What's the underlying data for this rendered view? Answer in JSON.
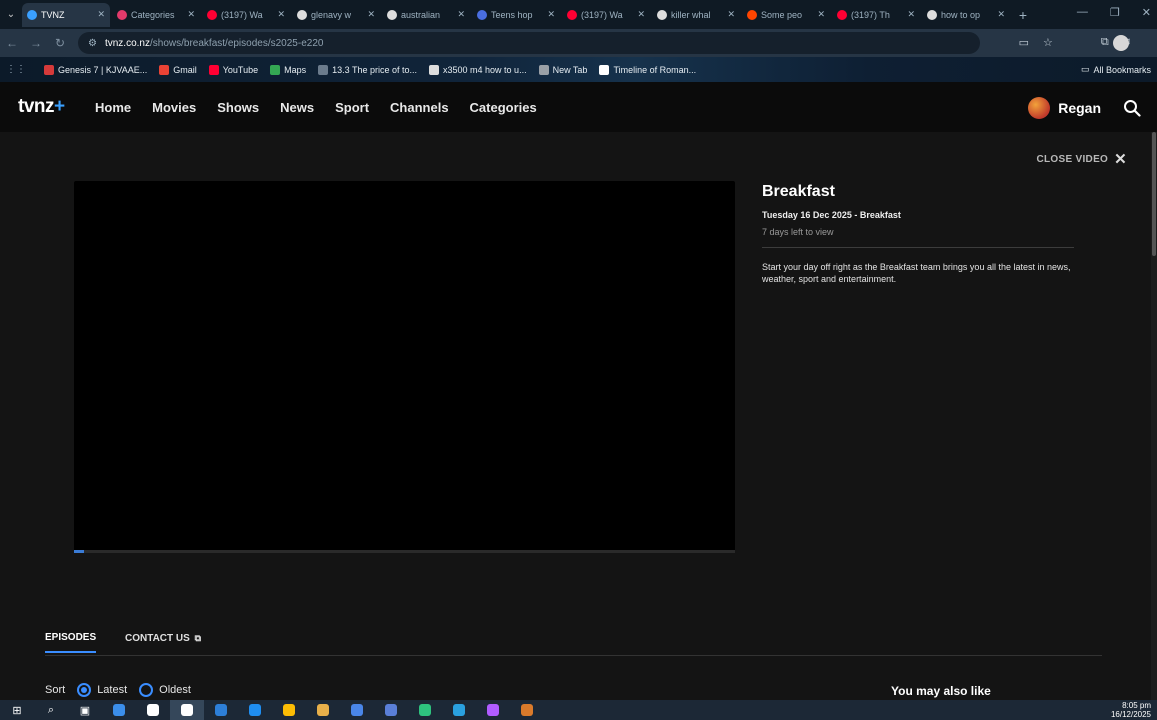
{
  "browser": {
    "tabs": [
      {
        "title": "TVNZ",
        "active": true,
        "icon_color": "#3aa0ff"
      },
      {
        "title": "Categories",
        "active": false,
        "icon_color": "#e23a6b"
      },
      {
        "title": "(3197) Wa",
        "active": false,
        "icon_color": "#ff0033"
      },
      {
        "title": "glenavy w",
        "active": false,
        "icon_color": "#dddddd"
      },
      {
        "title": "australian",
        "active": false,
        "icon_color": "#dddddd"
      },
      {
        "title": "Teens hop",
        "active": false,
        "icon_color": "#4a6ee0"
      },
      {
        "title": "(3197) Wa",
        "active": false,
        "icon_color": "#ff0033"
      },
      {
        "title": "killer whal",
        "active": false,
        "icon_color": "#dddddd"
      },
      {
        "title": "Some peo",
        "active": false,
        "icon_color": "#ff4500"
      },
      {
        "title": "(3197) Th",
        "active": false,
        "icon_color": "#ff0033"
      },
      {
        "title": "how to op",
        "active": false,
        "icon_color": "#dddddd"
      }
    ],
    "url_host": "tvnz.co.nz",
    "url_path": "/shows/breakfast/episodes/s2025-e220",
    "bookmarks": [
      {
        "label": "Genesis 7 | KJVAAE...",
        "icon_color": "#d63a3a"
      },
      {
        "label": "Gmail",
        "icon_color": "#ea4335"
      },
      {
        "label": "YouTube",
        "icon_color": "#ff0033"
      },
      {
        "label": "Maps",
        "icon_color": "#34a853"
      },
      {
        "label": "13.3 The price of to...",
        "icon_color": "#6b7b8c"
      },
      {
        "label": "x3500 m4 how to u...",
        "icon_color": "#dddddd"
      },
      {
        "label": "New Tab",
        "icon_color": "#9aa0a6"
      },
      {
        "label": "Timeline of Roman...",
        "icon_color": "#ffffff"
      }
    ],
    "all_bookmarks": "All Bookmarks"
  },
  "site": {
    "logo_text": "tvnz",
    "logo_plus": "+",
    "nav": [
      "Home",
      "Movies",
      "Shows",
      "News",
      "Sport",
      "Channels",
      "Categories"
    ],
    "user_name": "Regan",
    "close_video": "CLOSE VIDEO",
    "close_glyph": "✕"
  },
  "episode": {
    "title": "Breakfast",
    "date_line": "Tuesday 16 Dec 2025 - Breakfast",
    "days_left": "7 days left to view",
    "description": "Start your day off right as the Breakfast team brings you all the latest in news, weather, sport and entertainment.",
    "progress_fraction": 0.015
  },
  "section_tabs": {
    "episodes": "EPISODES",
    "contact": "CONTACT US"
  },
  "sort": {
    "label": "Sort",
    "options": [
      "Latest",
      "Oldest"
    ],
    "selected": "Latest"
  },
  "sidebar_heading": "You may also like",
  "taskbar": {
    "time": "8:05 pm",
    "date": "16/12/2025",
    "app_colors": [
      "#3b8eea",
      "#ffffff",
      "#ffffff",
      "#2d7fd8",
      "#1f8ef1",
      "#fbbc04",
      "#e8b04a",
      "#4a86e8",
      "#5a7fd8",
      "#2ec27e",
      "#2aa1e0",
      "#b05cff",
      "#d97a2b"
    ]
  },
  "colors": {
    "accent": "#3a8dff",
    "page_bg": "#141414"
  }
}
